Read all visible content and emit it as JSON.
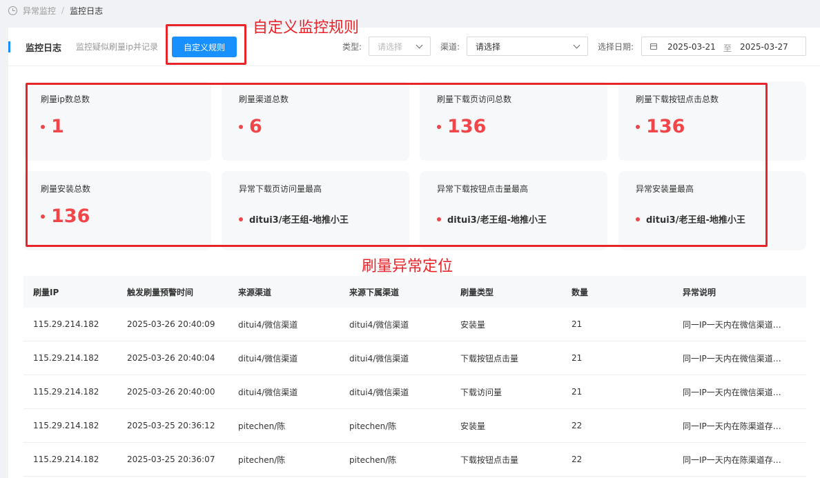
{
  "breadcrumb": {
    "parent": "异常监控",
    "separator": "/",
    "current": "监控日志"
  },
  "toolbar": {
    "title": "监控日志",
    "subtitle": "监控疑似刷量ip并记录",
    "custom_rule_button": "自定义规则",
    "type_label": "类型:",
    "type_placeholder": "请选择",
    "channel_label": "渠道:",
    "channel_value": "请选择",
    "date_label": "选择日期:",
    "date_start": "2025-03-21",
    "date_to": "至",
    "date_end": "2025-03-27"
  },
  "stats": [
    {
      "label": "刷量ip数总数",
      "value": "1"
    },
    {
      "label": "刷量渠道总数",
      "value": "6"
    },
    {
      "label": "刷量下载页访问总数",
      "value": "136"
    },
    {
      "label": "刷量下载按钮点击总数",
      "value": "136"
    },
    {
      "label": "刷量安装总数",
      "value": "136"
    },
    {
      "label": "异常下载页访问量最高",
      "value": "ditui3/老王组-地推小王"
    },
    {
      "label": "异常下载按钮点击量最高",
      "value": "ditui3/老王组-地推小王"
    },
    {
      "label": "异常安装量最高",
      "value": "ditui3/老王组-地推小王"
    }
  ],
  "table": {
    "columns": [
      "刷量IP",
      "触发刷量预警时间",
      "来源渠道",
      "来源下属渠道",
      "刷量类型",
      "数量",
      "异常说明"
    ],
    "rows": [
      [
        "115.29.214.182",
        "2025-03-26 20:40:09",
        "ditui4/微信渠道",
        "ditui4/微信渠道",
        "安装量",
        "21",
        "同一IP一天内在微信渠道…"
      ],
      [
        "115.29.214.182",
        "2025-03-26 20:40:04",
        "ditui4/微信渠道",
        "ditui4/微信渠道",
        "下载按钮点击量",
        "21",
        "同一IP一天内在微信渠道…"
      ],
      [
        "115.29.214.182",
        "2025-03-26 20:40:00",
        "ditui4/微信渠道",
        "ditui4/微信渠道",
        "下载访问量",
        "21",
        "同一IP一天内在微信渠道…"
      ],
      [
        "115.29.214.182",
        "2025-03-25 20:36:12",
        "pitechen/陈",
        "pitechen/陈",
        "安装量",
        "22",
        "同一IP一天内在陈渠道存…"
      ],
      [
        "115.29.214.182",
        "2025-03-25 20:36:07",
        "pitechen/陈",
        "pitechen/陈",
        "下载按钮点击量",
        "22",
        "同一IP一天内在陈渠道存…"
      ]
    ]
  },
  "annotations": {
    "custom_rule": "自定义监控规则",
    "abnormal_locate": "刷量异常定位",
    "color": "#e8242b"
  },
  "colors": {
    "accent": "#1890ff",
    "stat_value": "#f0464a"
  }
}
